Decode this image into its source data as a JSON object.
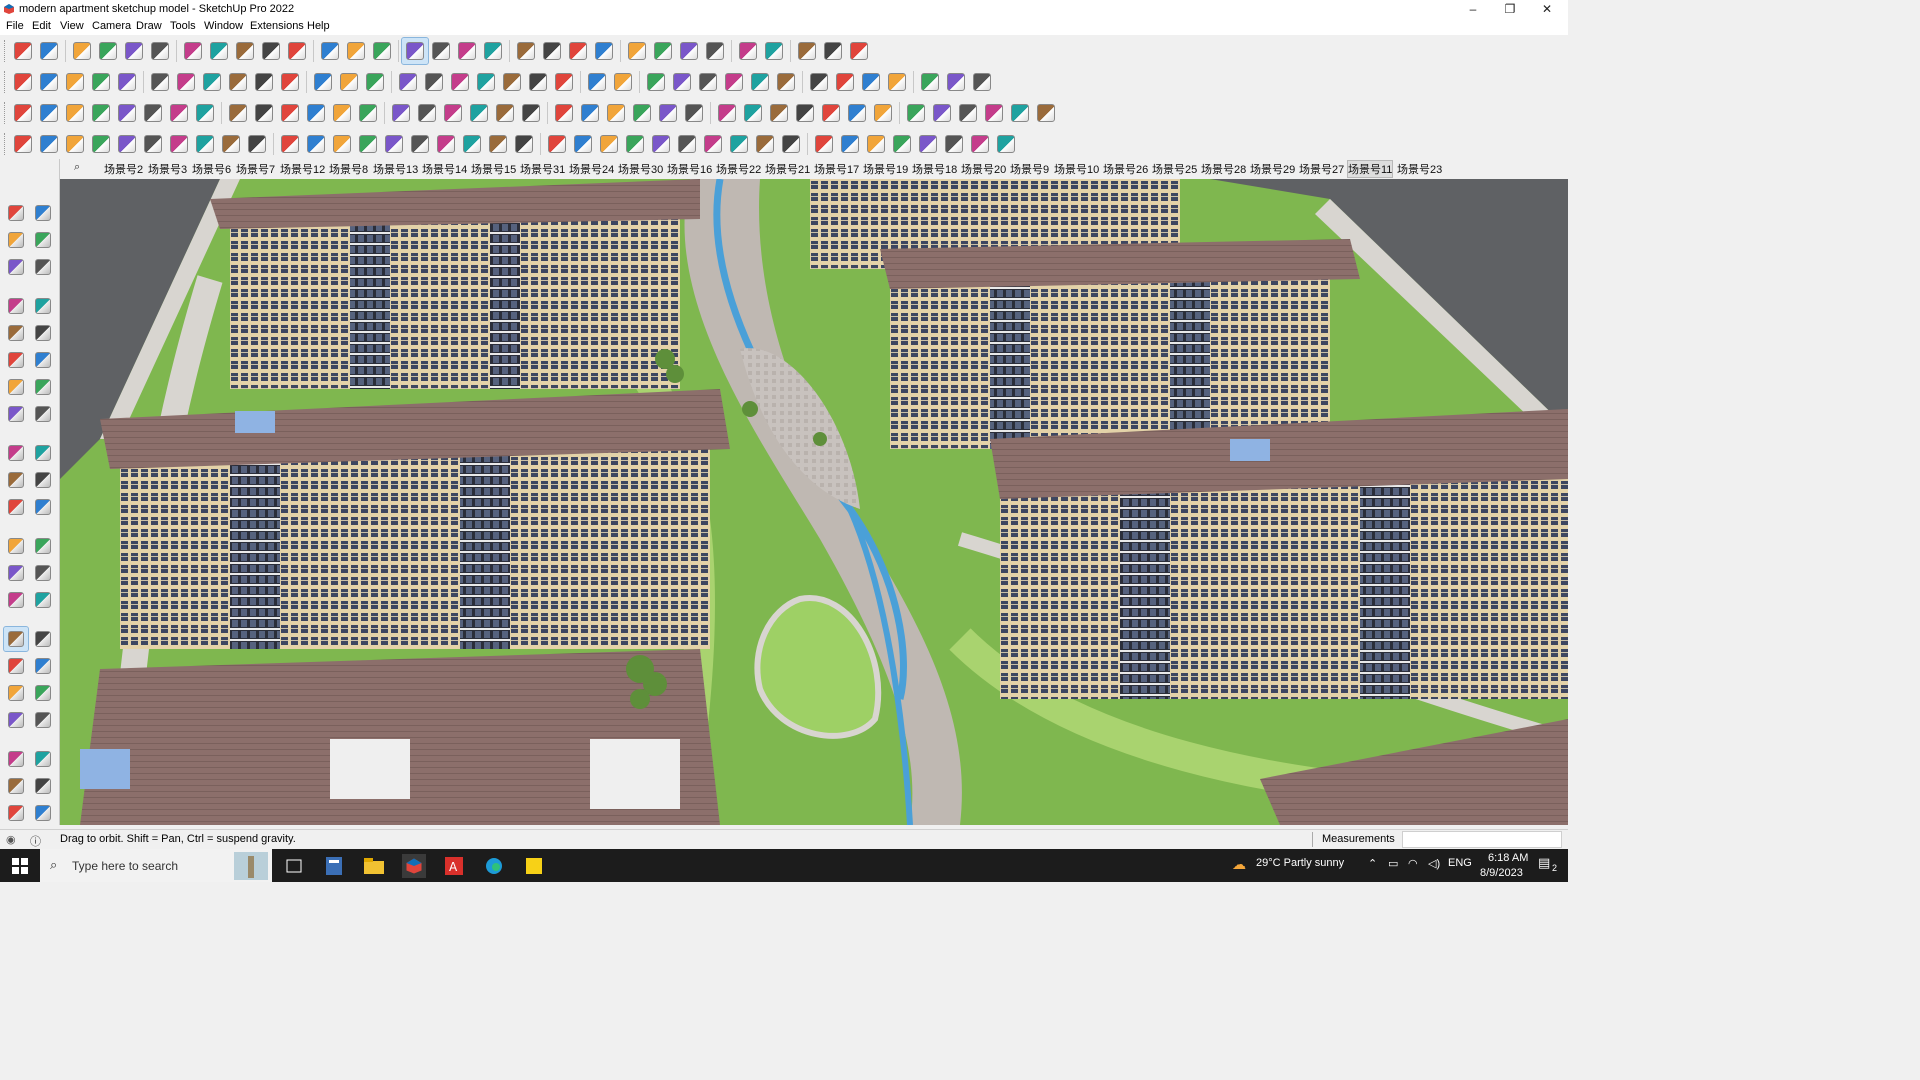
{
  "window": {
    "title": "modern apartment sketchup model - SketchUp Pro 2022",
    "app_icon": "sketchup-icon",
    "controls": {
      "minimize": "–",
      "maximize": "❐",
      "close": "✕"
    }
  },
  "menu": [
    "File",
    "Edit",
    "View",
    "Camera",
    "Draw",
    "Tools",
    "Window",
    "Extensions",
    "Help"
  ],
  "toolbars": {
    "row1_icons": [
      "zoom-icon",
      "select-icon",
      "eraser-icon",
      "pencil-icon",
      "arc-icon",
      "shape-icon",
      "pushpull-icon",
      "followme-icon",
      "move-icon",
      "rotate-icon",
      "scale-icon",
      "tape-icon",
      "text-icon",
      "paint-icon",
      "orbit-icon",
      "pan-icon",
      "zoom-tool-icon",
      "zoom-extents-icon",
      "section-icon",
      "layers-icon",
      "components-icon",
      "styles-icon",
      "account-icon",
      "warehouse-icon",
      "extension-icon",
      "sandbox-icon",
      "flip-icon",
      "solid-icon",
      "undo-icon",
      "redo-icon",
      "ruby-icon"
    ],
    "row2_icons": [
      "iso-icon",
      "top-icon",
      "front-icon",
      "shaded-icon",
      "xray-icon",
      "solid-union-icon",
      "intersect-icon",
      "subtract-icon",
      "trim-icon",
      "split-icon",
      "cut-icon",
      "outer-shell-icon",
      "materials-icon",
      "paint-match-icon",
      "3dtext-icon",
      "house-icon",
      "roof-icon",
      "door-icon",
      "window-icon",
      "stair-icon",
      "fence-icon",
      "curve-icon",
      "leaf-icon",
      "pen-icon",
      "circle-icon",
      "polygon-icon",
      "rectangle-icon",
      "ellipse-icon",
      "offset-icon",
      "bezier-icon",
      "weld-icon",
      "arrow-icon",
      "fill-icon",
      "texture-icon",
      "render-icon",
      "plugin-icon"
    ],
    "row3_icons": [
      "box-icon",
      "cylinder-icon",
      "cone-icon",
      "sphere-icon",
      "torus-icon",
      "tube-icon",
      "wedge-icon",
      "plane-icon",
      "arc-rotate-icon",
      "stop-icon",
      "grid-icon",
      "flag-icon",
      "cube-icon",
      "joint-icon",
      "curve-edit-icon",
      "cross-icon",
      "move-plus-icon",
      "mirror-icon",
      "tri-icon",
      "warn-icon",
      "spiral-icon",
      "loop-icon",
      "spin-icon",
      "target-icon",
      "bucket-icon",
      "refresh-icon",
      "leaf2-icon",
      "bevel-icon",
      "fillet-icon",
      "chamfer-icon",
      "extrude-icon",
      "align-icon",
      "ortho-icon",
      "flat-icon",
      "axes-icon",
      "dots-icon",
      "cut-tool-icon",
      "frame-icon",
      "panel-icon"
    ],
    "row4_icons": [
      "tile-a-icon",
      "tile-b-icon",
      "tile-c-icon",
      "tile-d-icon",
      "tile-e-icon",
      "tile-f-icon",
      "tile-g-icon",
      "tile-h-icon",
      "tile-i-icon",
      "tile-j-icon",
      "tile-k-icon",
      "tile-l-icon",
      "tile-m-icon",
      "tile-n-icon",
      "tile-o-icon",
      "tile-p-icon",
      "tile-q-icon",
      "tile-r-icon",
      "tile-s-icon",
      "tile-t-icon",
      "tile-u-icon",
      "tile-v-icon",
      "tile-w-icon",
      "tile-x-icon",
      "tile-y-icon",
      "tile-z-icon",
      "tile-aa-icon",
      "tile-ab-icon",
      "tile-ac-icon",
      "tile-ad-icon",
      "tile-ae-icon",
      "tile-af-icon",
      "tile-ag-icon",
      "tile-ah-icon",
      "tile-ai-icon",
      "tile-aj-icon",
      "tile-ak-icon",
      "tile-al-icon"
    ]
  },
  "scene_tabs": {
    "search_icon": "search-icon",
    "tabs": [
      "场景号2",
      "场景号3",
      "场景号6",
      "场景号7",
      "场景号12",
      "场景号8",
      "场景号13",
      "场景号14",
      "场景号15",
      "场景号31",
      "场景号24",
      "场景号30",
      "场景号16",
      "场景号22",
      "场景号21",
      "场景号17",
      "场景号19",
      "场景号18",
      "场景号20",
      "场景号9",
      "场景号10",
      "场景号26",
      "场景号25",
      "场景号28",
      "场景号29",
      "场景号27",
      "场景号11",
      "场景号23"
    ],
    "selected": "场景号11"
  },
  "left_tools": [
    "select-tool-icon",
    "orbit-tool-icon",
    "paint-tool-icon",
    "eraser-tool-icon",
    "components-tool-icon",
    "tape-tool-icon",
    "line-tool-icon",
    "freehand-tool-icon",
    "rectangle-tool-icon",
    "rotated-rect-tool-icon",
    "circle-tool-icon",
    "polygon-tool-icon",
    "arc-tool-icon",
    "pie-tool-icon",
    "arc3-tool-icon",
    "2ptarc-tool-icon",
    "move-tool-icon",
    "pushpull-tool-icon",
    "rotate-tool-icon",
    "followme-tool-icon",
    "scale-tool-icon",
    "offset-tool-icon",
    "tape2-tool-icon",
    "dimension-tool-icon",
    "protractor-tool-icon",
    "text-tool-icon",
    "axes-tool-icon",
    "3dtext-tool-icon",
    "orbit-active-icon",
    "pan-tool-icon",
    "zoom-tool-icon",
    "zoom-window-icon",
    "zoom-extents-tool-icon",
    "zoom-prev-icon",
    "position-camera-icon",
    "look-around-icon",
    "walk-icon",
    "section-plane-icon",
    "section-fill-icon",
    "section-display-icon",
    "section-cut-icon",
    "section-toggle-icon"
  ],
  "status": {
    "message": "Drag to orbit. Shift = Pan, Ctrl = suspend gravity.",
    "measurements_label": "Measurements",
    "measurements_value": ""
  },
  "taskbar": {
    "search_placeholder": "Type here to search",
    "weather": "29°C  Partly sunny",
    "lang": "ENG",
    "time": "6:18 AM",
    "date": "8/9/2023",
    "notification_badge": "2",
    "apps": [
      "start-icon",
      "task-view-icon",
      "calculator-icon",
      "file-explorer-icon",
      "sketchup-icon",
      "acrobat-icon",
      "edge-icon",
      "sticky-notes-icon"
    ]
  },
  "colors": {
    "accent": "#0078d7",
    "active_tool": "#cde4f7",
    "taskbar": "#1c1c1c",
    "roof": "#8c6f6b",
    "facade": "#e3d2a8",
    "grass": "#7fb74f",
    "water": "#4aa0d8"
  }
}
